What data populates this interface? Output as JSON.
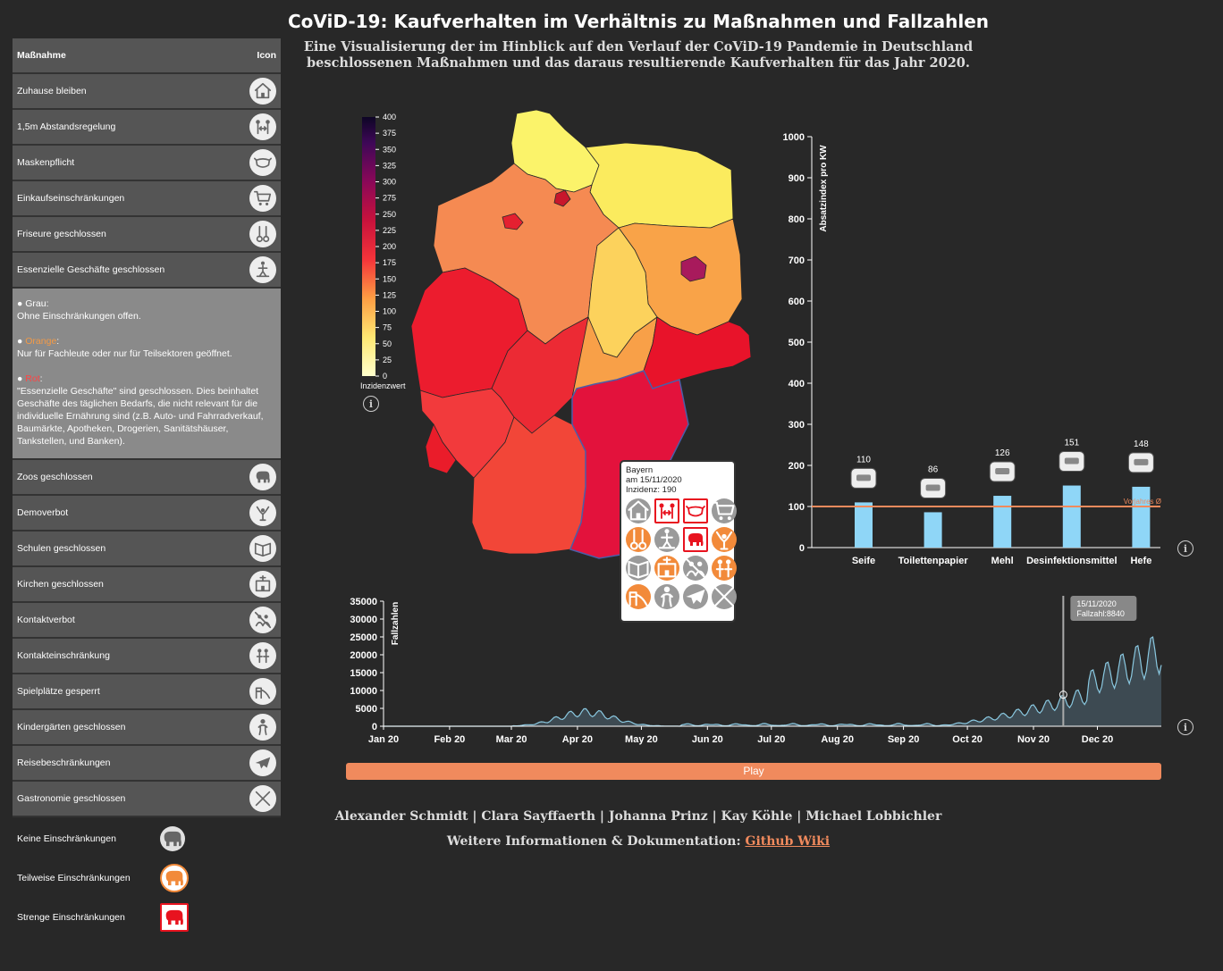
{
  "title": "CoViD-19: Kaufverhalten im Verhältnis zu Maßnahmen und Fallzahlen",
  "subtitle_line1": "Eine Visualisierung der im Hinblick auf den Verlauf der CoViD-19 Pandemie in Deutschland",
  "subtitle_line2": "beschlossenen Maßnahmen und das daraus resultierende Kaufverhalten für das Jahr 2020.",
  "sidebar": {
    "header_measure": "Maßnahme",
    "header_icon": "Icon",
    "items_top": [
      {
        "label": "Zuhause bleiben",
        "icon": "house-icon"
      },
      {
        "label": "1,5m Abstandsregelung",
        "icon": "distance-icon"
      },
      {
        "label": "Maskenpflicht",
        "icon": "mask-icon"
      },
      {
        "label": "Einkaufseinschränkungen",
        "icon": "cart-icon"
      },
      {
        "label": "Friseure geschlossen",
        "icon": "scissors-icon"
      },
      {
        "label": "Essenzielle Geschäfte geschlossen",
        "icon": "store-icon"
      }
    ],
    "legend_grau_title": "Grau",
    "legend_grau_text": "Ohne Einschränkungen offen.",
    "legend_orange_title": "Orange",
    "legend_orange_text": "Nur für Fachleute oder nur für Teilsektoren geöffnet.",
    "legend_rot_title": "Rot",
    "legend_rot_text": "\"Essenzielle Geschäfte\" sind geschlossen. Dies beinhaltet Geschäfte des täglichen Bedarfs, die nicht relevant für die individuelle Ernährung sind (z.B. Auto- und Fahrradverkauf, Baumärkte, Apotheken, Drogerien, Sanitätshäuser, Tankstellen, und Banken).",
    "items_bottom": [
      {
        "label": "Zoos geschlossen",
        "icon": "elephant-icon"
      },
      {
        "label": "Demoverbot",
        "icon": "demo-icon"
      },
      {
        "label": "Schulen geschlossen",
        "icon": "school-icon"
      },
      {
        "label": "Kirchen geschlossen",
        "icon": "church-icon"
      },
      {
        "label": "Kontaktverbot",
        "icon": "no-contact-icon"
      },
      {
        "label": "Kontakteinschränkung",
        "icon": "people-icon"
      },
      {
        "label": "Spielplätze gesperrt",
        "icon": "playground-icon"
      },
      {
        "label": "Kindergärten geschlossen",
        "icon": "child-icon"
      },
      {
        "label": "Reisebeschränkungen",
        "icon": "plane-icon"
      },
      {
        "label": "Gastronomie geschlossen",
        "icon": "cutlery-icon"
      }
    ],
    "key": [
      {
        "label": "Keine Einschränkungen",
        "color": "#e0e0e0"
      },
      {
        "label": "Teilweise Einschränkungen",
        "color": "#f28a3a"
      },
      {
        "label": "Strenge Einschränkungen",
        "color": "#e8131f"
      }
    ]
  },
  "colors": {
    "accent": "#f08a5d",
    "bar": "#8fd6f7",
    "vorjahr_line": "#f08a5d",
    "cases_fill": "#3d4a52",
    "cases_line": "#8ac8e0"
  },
  "map": {
    "legend_ticks": [
      "400",
      "375",
      "350",
      "325",
      "300",
      "275",
      "250",
      "225",
      "200",
      "175",
      "150",
      "125",
      "100",
      "75",
      "50",
      "25",
      "0"
    ],
    "legend_label": "Inzidenzwert",
    "states": [
      {
        "name": "Schleswig-Holstein",
        "color": "#fbf36a"
      },
      {
        "name": "Mecklenburg-Vorpommern",
        "color": "#fbeb5e"
      },
      {
        "name": "Niedersachsen",
        "color": "#f58a52"
      },
      {
        "name": "Brandenburg",
        "color": "#f9a348"
      },
      {
        "name": "Sachsen-Anhalt",
        "color": "#fcd25c"
      },
      {
        "name": "Berlin",
        "color": "#a81a5c"
      },
      {
        "name": "Nordrhein-Westfalen",
        "color": "#ec1c2e"
      },
      {
        "name": "Hessen",
        "color": "#ec2a34"
      },
      {
        "name": "Thüringen",
        "color": "#f8a048"
      },
      {
        "name": "Sachsen",
        "color": "#e8132a"
      },
      {
        "name": "Rheinland-Pfalz",
        "color": "#f23a3c"
      },
      {
        "name": "Saarland",
        "color": "#ea1c2a"
      },
      {
        "name": "Baden-Württemberg",
        "color": "#f24638"
      },
      {
        "name": "Bayern",
        "color": "#e3123c"
      },
      {
        "name": "Hamburg",
        "color": "#c8162c"
      },
      {
        "name": "Bremen",
        "color": "#e42030"
      }
    ]
  },
  "tooltip": {
    "state": "Bayern",
    "date": "am 15/11/2020",
    "incidence": "Inzidenz: 190",
    "icons": [
      {
        "name": "house-icon",
        "level": "grey"
      },
      {
        "name": "distance-icon",
        "level": "red"
      },
      {
        "name": "mask-icon",
        "level": "red"
      },
      {
        "name": "cart-icon",
        "level": "grey"
      },
      {
        "name": "scissors-icon",
        "level": "orange"
      },
      {
        "name": "store-icon",
        "level": "grey"
      },
      {
        "name": "elephant-icon",
        "level": "red"
      },
      {
        "name": "demo-icon",
        "level": "orange"
      },
      {
        "name": "school-icon",
        "level": "grey"
      },
      {
        "name": "church-icon",
        "level": "orange"
      },
      {
        "name": "no-contact-icon",
        "level": "grey"
      },
      {
        "name": "people-icon",
        "level": "orange"
      },
      {
        "name": "playground-icon",
        "level": "orange"
      },
      {
        "name": "child-icon",
        "level": "grey"
      },
      {
        "name": "plane-icon",
        "level": "grey"
      },
      {
        "name": "cutlery-icon",
        "level": "grey"
      }
    ]
  },
  "chart_data": [
    {
      "type": "bar",
      "ylabel": "Absatzindex pro KW",
      "ylim": [
        0,
        1000
      ],
      "yticks": [
        0,
        100,
        200,
        300,
        400,
        500,
        600,
        700,
        800,
        900,
        1000
      ],
      "categories": [
        "Seife",
        "Toilettenpapier",
        "Mehl",
        "Desinfektionsmittel",
        "Hefe"
      ],
      "values": [
        110,
        86,
        126,
        151,
        148
      ],
      "reference_label": "Vorjahres Ø",
      "reference_value": 100
    },
    {
      "type": "area",
      "ylabel": "Fallzahlen",
      "ylim": [
        0,
        35000
      ],
      "yticks": [
        0,
        5000,
        10000,
        15000,
        20000,
        25000,
        30000,
        35000
      ],
      "xticks": [
        "Jan 20",
        "Feb 20",
        "Mar 20",
        "Apr 20",
        "May 20",
        "Jun 20",
        "Jul 20",
        "Aug 20",
        "Sep 20",
        "Oct 20",
        "Nov 20",
        "Dec 20"
      ],
      "x_start": "2020-01-01",
      "x_end": "2020-12-31",
      "marker_date": "15/11/2020",
      "marker_label": "Fallzahl:8840",
      "marker_value": 8840
    }
  ],
  "play_label": "Play",
  "authors": "Alexander Schmidt | Clara Sayffaerth | Johanna Prinz | Kay Köhle | Michael Lobbichler",
  "more_prefix": "Weitere Informationen & Dokumentation: ",
  "more_link": "Github Wiki"
}
